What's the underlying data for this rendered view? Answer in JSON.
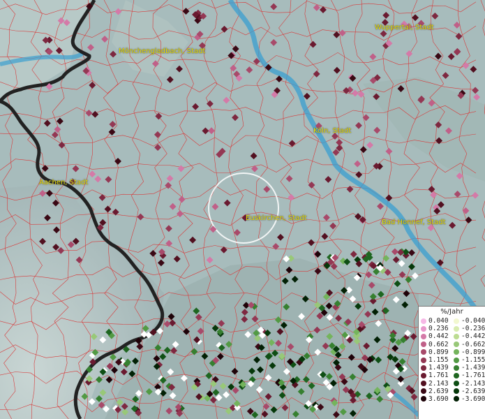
{
  "map": {
    "cities": [
      {
        "id": "wuppertal",
        "name": "Wuppertal, Stadt"
      },
      {
        "id": "moenchengladbach",
        "name": "Mönchengladbach, Stadt"
      },
      {
        "id": "koeln",
        "name": "Köln, Stadt"
      },
      {
        "id": "aachen",
        "name": "Aachen, Stadt"
      },
      {
        "id": "euskirchen",
        "name": "Euskirchen, Stadt"
      },
      {
        "id": "bad-honnef",
        "name": "Bad Honnef, Stadt"
      }
    ]
  },
  "legend": {
    "title": "%/Jahr",
    "positive": [
      {
        "label": "0.040",
        "color": "#f6b8e6"
      },
      {
        "label": "0.236",
        "color": "#e898cc"
      },
      {
        "label": "0.442",
        "color": "#d47aa8"
      },
      {
        "label": "0.662",
        "color": "#c06088"
      },
      {
        "label": "0.899",
        "color": "#a84a6a"
      },
      {
        "label": "1.155",
        "color": "#943854"
      },
      {
        "label": "1.439",
        "color": "#7e2840"
      },
      {
        "label": "1.761",
        "color": "#6a1a30"
      },
      {
        "label": "2.143",
        "color": "#521020"
      },
      {
        "label": "2.639",
        "color": "#3a0814"
      },
      {
        "label": "3.690",
        "color": "#1e0208"
      }
    ],
    "negative": [
      {
        "label": "-0.040",
        "color": "#f2f8d0"
      },
      {
        "label": "-0.236",
        "color": "#d8ecb0"
      },
      {
        "label": "-0.442",
        "color": "#bcdc92"
      },
      {
        "label": "-0.662",
        "color": "#98c878"
      },
      {
        "label": "-0.899",
        "color": "#74b45c"
      },
      {
        "label": "-1.155",
        "color": "#529a44"
      },
      {
        "label": "-1.439",
        "color": "#368030"
      },
      {
        "label": "-1.761",
        "color": "#1e6620"
      },
      {
        "label": "-2.143",
        "color": "#0e4e14"
      },
      {
        "label": "-2.639",
        "color": "#06380a"
      },
      {
        "label": "-3.690",
        "color": "#022004"
      }
    ]
  }
}
